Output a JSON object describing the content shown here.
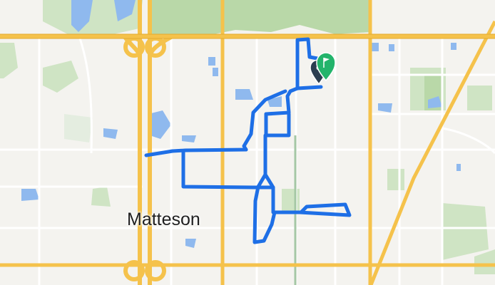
{
  "map": {
    "place_labels": {
      "town": "Matteson"
    },
    "icons": {
      "start_marker": "flag-pin-icon",
      "end_marker": "location-pin-icon"
    },
    "colors": {
      "land": "#f4f3ef",
      "park_green": "#cfe4c4",
      "forest_green": "#b9d8a8",
      "water": "#8fb9ee",
      "road_major": "#f5c24b",
      "road_minor": "#ffffff",
      "rail": "#a5c7a5",
      "route": "#1e6fe6",
      "start_pin": "#23b46b",
      "end_pin": "#2c3e50"
    }
  }
}
